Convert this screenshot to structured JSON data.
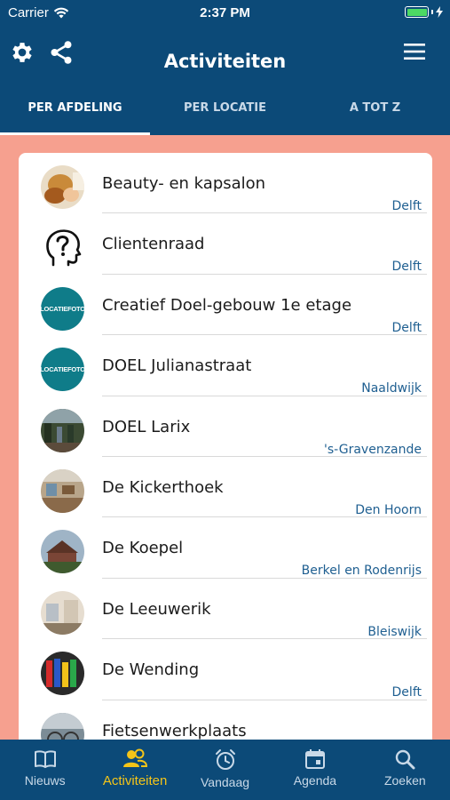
{
  "status": {
    "carrier": "Carrier",
    "time": "2:37 PM"
  },
  "header": {
    "title": "Activiteiten",
    "left_icons": [
      "gear-icon",
      "share-icon"
    ],
    "right_icon": "menu-icon"
  },
  "tabs": [
    {
      "label": "PER AFDELING",
      "active": true
    },
    {
      "label": "PER LOCATIE",
      "active": false
    },
    {
      "label": "A TOT Z",
      "active": false
    }
  ],
  "list": [
    {
      "name": "Beauty- en kapsalon",
      "location": "Delft",
      "avatar": "photo"
    },
    {
      "name": "Clientenraad",
      "location": "Delft",
      "avatar": "question-head-icon"
    },
    {
      "name": "Creatief Doel-gebouw 1e etage",
      "location": "Delft",
      "avatar": "locatiefoto",
      "avatar_text": "LOCATIEFOTO"
    },
    {
      "name": "DOEL Julianastraat",
      "location": "Naaldwijk",
      "avatar": "locatiefoto",
      "avatar_text": "LOCATIEFOTO"
    },
    {
      "name": "DOEL Larix",
      "location": "'s-Gravenzande",
      "avatar": "photo"
    },
    {
      "name": "De Kickerthoek",
      "location": "Den Hoorn",
      "avatar": "photo"
    },
    {
      "name": "De Koepel",
      "location": "Berkel en Rodenrijs",
      "avatar": "photo"
    },
    {
      "name": "De Leeuwerik",
      "location": "Bleiswijk",
      "avatar": "photo"
    },
    {
      "name": "De Wending",
      "location": "Delft",
      "avatar": "photo"
    },
    {
      "name": "Fietsenwerkplaats",
      "location": "",
      "avatar": "photo"
    }
  ],
  "bottom_tabs": [
    {
      "label": "Nieuws",
      "icon": "book-icon",
      "active": false
    },
    {
      "label": "Activiteiten",
      "icon": "people-icon",
      "active": true
    },
    {
      "label": "Vandaag",
      "icon": "alarm-clock-icon",
      "active": false
    },
    {
      "label": "Agenda",
      "icon": "calendar-icon",
      "active": false
    },
    {
      "label": "Zoeken",
      "icon": "search-icon",
      "active": false
    }
  ],
  "colors": {
    "primary": "#0c4a78",
    "background": "#f6a08f",
    "accent": "#f5c518",
    "location_text": "#1f5f91",
    "locatiefoto": "#0f7c89"
  }
}
